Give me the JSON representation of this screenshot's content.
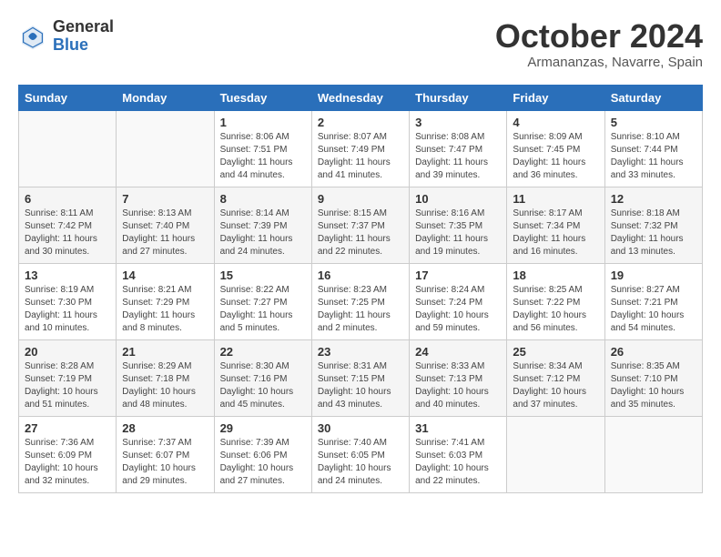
{
  "header": {
    "logo_general": "General",
    "logo_blue": "Blue",
    "month_title": "October 2024",
    "location": "Armananzas, Navarre, Spain"
  },
  "days_of_week": [
    "Sunday",
    "Monday",
    "Tuesday",
    "Wednesday",
    "Thursday",
    "Friday",
    "Saturday"
  ],
  "weeks": [
    [
      {
        "day": "",
        "detail": ""
      },
      {
        "day": "",
        "detail": ""
      },
      {
        "day": "1",
        "detail": "Sunrise: 8:06 AM\nSunset: 7:51 PM\nDaylight: 11 hours\nand 44 minutes."
      },
      {
        "day": "2",
        "detail": "Sunrise: 8:07 AM\nSunset: 7:49 PM\nDaylight: 11 hours\nand 41 minutes."
      },
      {
        "day": "3",
        "detail": "Sunrise: 8:08 AM\nSunset: 7:47 PM\nDaylight: 11 hours\nand 39 minutes."
      },
      {
        "day": "4",
        "detail": "Sunrise: 8:09 AM\nSunset: 7:45 PM\nDaylight: 11 hours\nand 36 minutes."
      },
      {
        "day": "5",
        "detail": "Sunrise: 8:10 AM\nSunset: 7:44 PM\nDaylight: 11 hours\nand 33 minutes."
      }
    ],
    [
      {
        "day": "6",
        "detail": "Sunrise: 8:11 AM\nSunset: 7:42 PM\nDaylight: 11 hours\nand 30 minutes."
      },
      {
        "day": "7",
        "detail": "Sunrise: 8:13 AM\nSunset: 7:40 PM\nDaylight: 11 hours\nand 27 minutes."
      },
      {
        "day": "8",
        "detail": "Sunrise: 8:14 AM\nSunset: 7:39 PM\nDaylight: 11 hours\nand 24 minutes."
      },
      {
        "day": "9",
        "detail": "Sunrise: 8:15 AM\nSunset: 7:37 PM\nDaylight: 11 hours\nand 22 minutes."
      },
      {
        "day": "10",
        "detail": "Sunrise: 8:16 AM\nSunset: 7:35 PM\nDaylight: 11 hours\nand 19 minutes."
      },
      {
        "day": "11",
        "detail": "Sunrise: 8:17 AM\nSunset: 7:34 PM\nDaylight: 11 hours\nand 16 minutes."
      },
      {
        "day": "12",
        "detail": "Sunrise: 8:18 AM\nSunset: 7:32 PM\nDaylight: 11 hours\nand 13 minutes."
      }
    ],
    [
      {
        "day": "13",
        "detail": "Sunrise: 8:19 AM\nSunset: 7:30 PM\nDaylight: 11 hours\nand 10 minutes."
      },
      {
        "day": "14",
        "detail": "Sunrise: 8:21 AM\nSunset: 7:29 PM\nDaylight: 11 hours\nand 8 minutes."
      },
      {
        "day": "15",
        "detail": "Sunrise: 8:22 AM\nSunset: 7:27 PM\nDaylight: 11 hours\nand 5 minutes."
      },
      {
        "day": "16",
        "detail": "Sunrise: 8:23 AM\nSunset: 7:25 PM\nDaylight: 11 hours\nand 2 minutes."
      },
      {
        "day": "17",
        "detail": "Sunrise: 8:24 AM\nSunset: 7:24 PM\nDaylight: 10 hours\nand 59 minutes."
      },
      {
        "day": "18",
        "detail": "Sunrise: 8:25 AM\nSunset: 7:22 PM\nDaylight: 10 hours\nand 56 minutes."
      },
      {
        "day": "19",
        "detail": "Sunrise: 8:27 AM\nSunset: 7:21 PM\nDaylight: 10 hours\nand 54 minutes."
      }
    ],
    [
      {
        "day": "20",
        "detail": "Sunrise: 8:28 AM\nSunset: 7:19 PM\nDaylight: 10 hours\nand 51 minutes."
      },
      {
        "day": "21",
        "detail": "Sunrise: 8:29 AM\nSunset: 7:18 PM\nDaylight: 10 hours\nand 48 minutes."
      },
      {
        "day": "22",
        "detail": "Sunrise: 8:30 AM\nSunset: 7:16 PM\nDaylight: 10 hours\nand 45 minutes."
      },
      {
        "day": "23",
        "detail": "Sunrise: 8:31 AM\nSunset: 7:15 PM\nDaylight: 10 hours\nand 43 minutes."
      },
      {
        "day": "24",
        "detail": "Sunrise: 8:33 AM\nSunset: 7:13 PM\nDaylight: 10 hours\nand 40 minutes."
      },
      {
        "day": "25",
        "detail": "Sunrise: 8:34 AM\nSunset: 7:12 PM\nDaylight: 10 hours\nand 37 minutes."
      },
      {
        "day": "26",
        "detail": "Sunrise: 8:35 AM\nSunset: 7:10 PM\nDaylight: 10 hours\nand 35 minutes."
      }
    ],
    [
      {
        "day": "27",
        "detail": "Sunrise: 7:36 AM\nSunset: 6:09 PM\nDaylight: 10 hours\nand 32 minutes."
      },
      {
        "day": "28",
        "detail": "Sunrise: 7:37 AM\nSunset: 6:07 PM\nDaylight: 10 hours\nand 29 minutes."
      },
      {
        "day": "29",
        "detail": "Sunrise: 7:39 AM\nSunset: 6:06 PM\nDaylight: 10 hours\nand 27 minutes."
      },
      {
        "day": "30",
        "detail": "Sunrise: 7:40 AM\nSunset: 6:05 PM\nDaylight: 10 hours\nand 24 minutes."
      },
      {
        "day": "31",
        "detail": "Sunrise: 7:41 AM\nSunset: 6:03 PM\nDaylight: 10 hours\nand 22 minutes."
      },
      {
        "day": "",
        "detail": ""
      },
      {
        "day": "",
        "detail": ""
      }
    ]
  ]
}
